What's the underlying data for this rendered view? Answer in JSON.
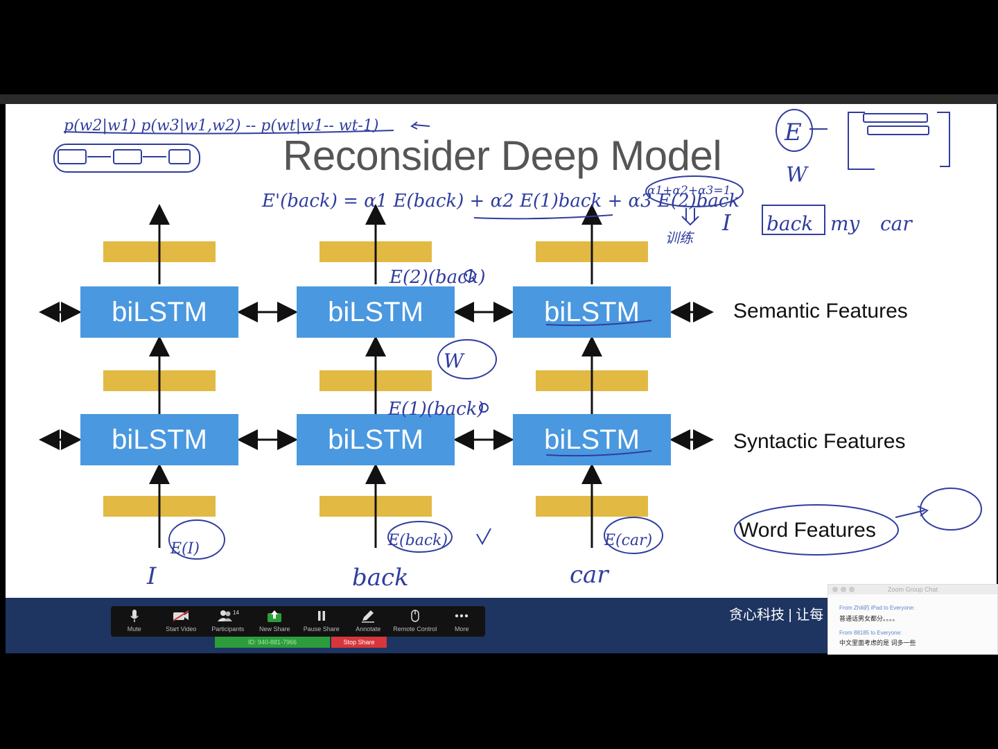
{
  "slide": {
    "title": "Reconsider Deep Model",
    "cell_label": "biLSTM",
    "features": {
      "semantic": "Semantic Features",
      "syntactic": "Syntactic Features",
      "word": "Word Features"
    }
  },
  "handwriting": {
    "formula_top": "p(w2|w1) p(w3|w1,w2) -- p(wt|w1-- wt-1)",
    "elmo_eq": "E'(back) = α1 E(back) + α2 E(1)back + α3 E(2)back",
    "sum_constraint": "α1+α2+α3=1",
    "train": "训练",
    "sentence": [
      "I",
      "back",
      "my",
      "car"
    ],
    "inputs": [
      "I",
      "back",
      "car"
    ],
    "e_labels": [
      "E(I)",
      "E(back)",
      "E(car)"
    ],
    "stack_labels": [
      "E(2)(back)",
      "E(1)(back)",
      "W",
      "E",
      "W"
    ]
  },
  "zoom_toolbar": {
    "items": [
      {
        "label": "Mute",
        "icon": "microphone-icon"
      },
      {
        "label": "Start Video",
        "icon": "video-off-icon"
      },
      {
        "label": "Participants",
        "icon": "participants-icon",
        "badge": "14"
      },
      {
        "label": "New Share",
        "icon": "share-screen-icon"
      },
      {
        "label": "Pause Share",
        "icon": "pause-icon"
      },
      {
        "label": "Annotate",
        "icon": "pen-icon"
      },
      {
        "label": "Remote Control",
        "icon": "mouse-icon"
      },
      {
        "label": "More",
        "icon": "more-icon"
      }
    ],
    "meeting_id": "ID: 940-881-7966",
    "stop_share": "Stop Share",
    "colors": {
      "share_green": "#2d9d3b",
      "stop_red": "#d6363c"
    }
  },
  "brand": "贪心科技 | 让每",
  "chat": {
    "title": "Zoom Group Chat",
    "messages": [
      {
        "from": "From Zhili的 iPad to Everyone:",
        "text": "普通话男女都分。。。。"
      },
      {
        "from": "From 88185 to Everyone:",
        "text": "中文里面考虑的是 词多一些"
      }
    ]
  }
}
